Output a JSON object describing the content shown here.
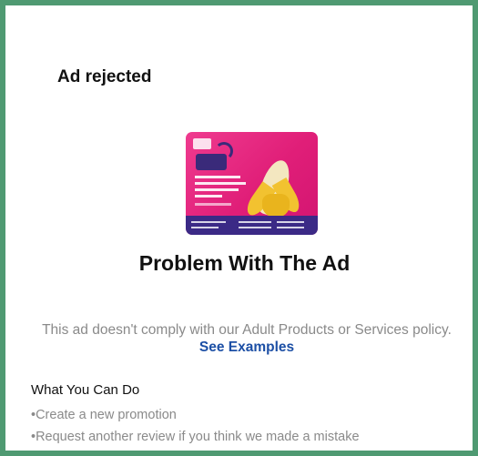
{
  "dialog": {
    "title": "Ad rejected",
    "heading": "Problem With The Ad",
    "description": "This ad doesn't comply with our Adult Products or Services policy.",
    "link_label": "See Examples",
    "section_title": "What You Can Do",
    "actions": [
      "•Create a new promotion",
      "•Request another review if you think we made a mistake"
    ]
  },
  "colors": {
    "border": "#4f9a72",
    "link": "#1c4fa5",
    "ad_background": "#e01e78"
  }
}
